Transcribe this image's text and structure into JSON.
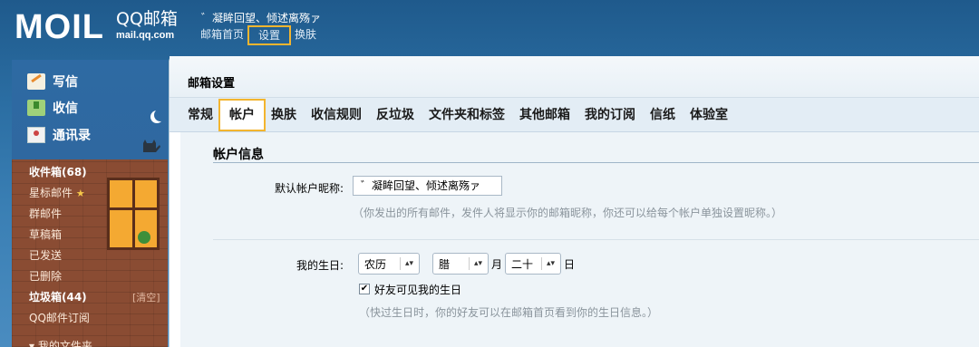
{
  "header": {
    "logo_text": "MOIL",
    "brand_name": "QQ邮箱",
    "brand_url": "mail.qq.com",
    "user_name": "゛凝眸回望、倾述离殇ァ",
    "nav": [
      "邮箱首页",
      "设置",
      "换肤"
    ],
    "active_nav": "设置"
  },
  "sidebar": {
    "quick_actions": [
      "写信",
      "收信",
      "通讯录"
    ],
    "folders": [
      "收件箱(68)",
      "星标邮件",
      "群邮件",
      "草稿箱",
      "已发送",
      "已删除",
      "垃圾箱(44)",
      "QQ邮件订阅",
      "我的文件夹"
    ],
    "clear_label": "[清空]"
  },
  "panel": {
    "title": "邮箱设置",
    "tabs": [
      "常规",
      "帐户",
      "换肤",
      "收信规则",
      "反垃圾",
      "文件夹和标签",
      "其他邮箱",
      "我的订阅",
      "信纸",
      "体验室"
    ],
    "active_tab": "帐户"
  },
  "account": {
    "section_title": "帐户信息",
    "nickname_label": "默认帐户昵称:",
    "nickname_value": "゛凝眸回望、倾述离殇ァ",
    "nickname_hint": "（你发出的所有邮件，发件人将显示你的邮箱昵称，你还可以给每个帐户单独设置昵称。）",
    "birthday_label": "我的生日:",
    "calendar_value": "农历",
    "month_value": "腊",
    "month_unit": "月",
    "day_value": "二十",
    "day_unit": "日",
    "friends_visible_label": "好友可见我的生日",
    "friends_visible_checked": true,
    "birthday_hint": "（快过生日时，你的好友可以在邮箱首页看到你的生日信息。）"
  },
  "colors": {
    "accent_outline": "#f3b52f",
    "sky": "#2b6ea3",
    "brick": "#8a4c33"
  }
}
